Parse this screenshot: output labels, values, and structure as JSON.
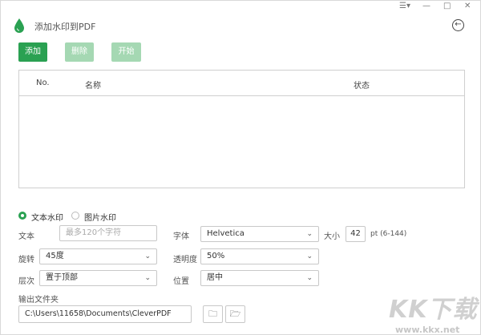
{
  "window": {
    "menu_icon": "☰▾",
    "minimize": "—",
    "maximize": "□",
    "close": "✕"
  },
  "app": {
    "title": "添加水印到PDF",
    "back_icon": "←",
    "accent_color": "#2aa152",
    "disabled_color": "#a5d8b3"
  },
  "toolbar": {
    "add_label": "添加",
    "delete_label": "删除",
    "start_label": "开始"
  },
  "table": {
    "col_no": "No.",
    "col_name": "名称",
    "col_status": "状态",
    "rows": []
  },
  "watermark_type": {
    "text_label": "文本水印",
    "image_label": "图片水印",
    "selected": "text"
  },
  "form": {
    "text_label": "文本",
    "text_placeholder": "最多120个字符",
    "font_label": "字体",
    "font_value": "Helvetica",
    "size_label": "大小",
    "size_value": "42",
    "size_hint": "pt (6-144)",
    "rotate_label": "旋转",
    "rotate_value": "45度",
    "opacity_label": "透明度",
    "opacity_value": "50%",
    "layer_label": "层次",
    "layer_value": "置于顶部",
    "position_label": "位置",
    "position_value": "居中",
    "output_label": "输出文件夹",
    "output_value": "C:\\Users\\11658\\Documents\\CleverPDF",
    "folder_icon": "🗀",
    "open_folder_icon": "🗁"
  },
  "watermark_site": {
    "logo_text": "KK下载",
    "url": "www.kkx.net"
  }
}
